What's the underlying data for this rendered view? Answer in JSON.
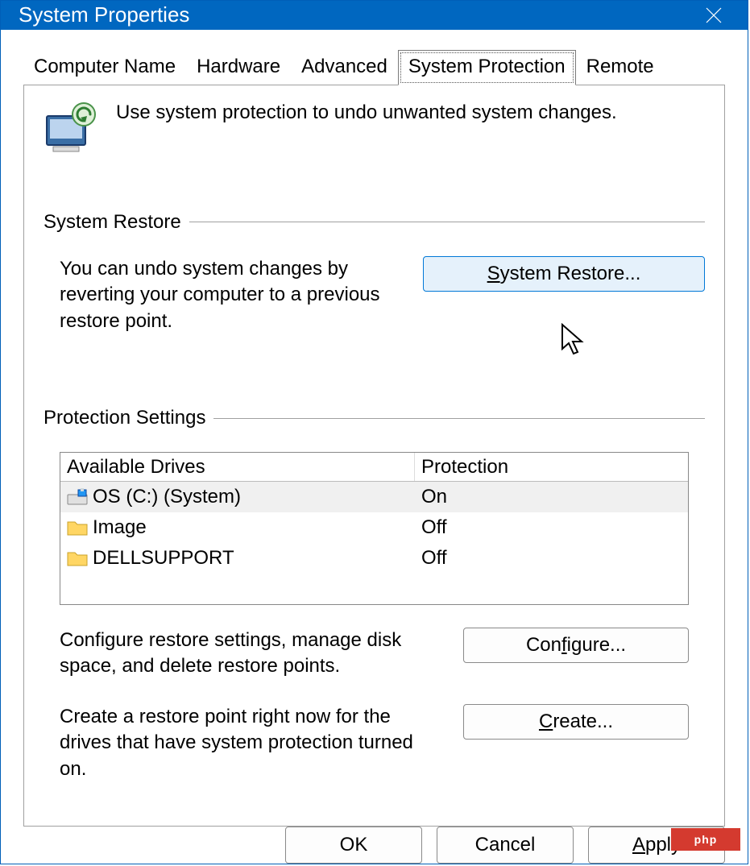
{
  "window": {
    "title": "System Properties"
  },
  "tabs": {
    "t0": "Computer Name",
    "t1": "Hardware",
    "t2": "Advanced",
    "t3": "System Protection",
    "t4": "Remote"
  },
  "intro": "Use system protection to undo unwanted system changes.",
  "restore": {
    "heading": "System Restore",
    "desc": "You can undo system changes by reverting your computer to a previous restore point.",
    "button_prefix": "S",
    "button_rest": "ystem Restore..."
  },
  "protection": {
    "heading": "Protection Settings",
    "col_a": "Available Drives",
    "col_b": "Protection",
    "drives": {
      "d0": {
        "name": "OS (C:) (System)",
        "status": "On"
      },
      "d1": {
        "name": "Image",
        "status": "Off"
      },
      "d2": {
        "name": "DELLSUPPORT",
        "status": "Off"
      }
    },
    "configure": {
      "desc": "Configure restore settings, manage disk space, and delete restore points.",
      "button_prefix": "C",
      "button_mid": "on",
      "button_ul2": "f",
      "button_rest": "igure..."
    },
    "create": {
      "desc": "Create a restore point right now for the drives that have system protection turned on.",
      "button_prefix": "C",
      "button_rest": "reate..."
    }
  },
  "footer": {
    "ok": "OK",
    "cancel": "Cancel",
    "apply_prefix": "A",
    "apply_rest": "pply"
  },
  "badge": "php"
}
